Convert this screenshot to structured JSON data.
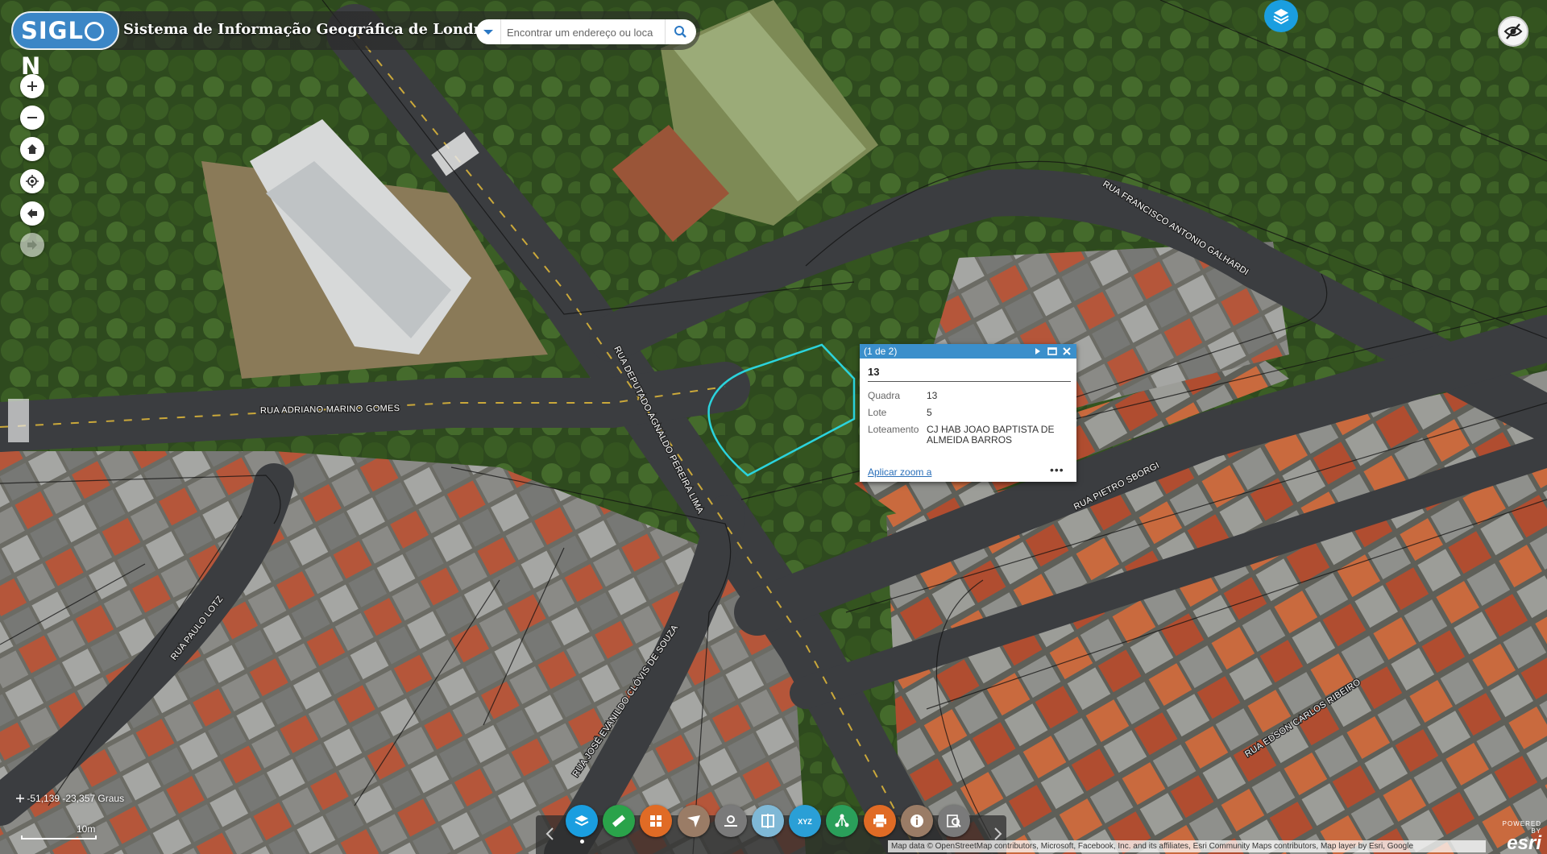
{
  "header": {
    "logo_text": "SIGLON",
    "title": "Sistema de Informação Geográfica de Londrina",
    "search_placeholder": "Encontrar um endereço ou loca"
  },
  "streets": [
    "RUA ADRIANO MARINO GOMES",
    "RUA DEPUTADO AGNALDO PEREIRA LIMA",
    "RUA FRANCISCO ANTONIO GALHARDI",
    "RUA PIETRO SBORGI",
    "RUA PAULO LOTZ",
    "RUA JOSÉ EVANILDO CLÓVIS DE SOUZA",
    "RUA EDSON CARLOS RIBEIRO"
  ],
  "popup": {
    "counter": "(1 de 2)",
    "title": "13",
    "fields": [
      {
        "key": "Quadra",
        "value": "13"
      },
      {
        "key": "Lote",
        "value": "5"
      },
      {
        "key": "Loteamento",
        "value": "CJ HAB JOAO BAPTISTA DE ALMEIDA BARROS"
      }
    ],
    "zoom_link": "Aplicar zoom a",
    "more": "•••"
  },
  "coordinates": "-51,139 -23,357 Graus",
  "scale_label": "10m",
  "attribution": "Map data © OpenStreetMap contributors, Microsoft, Facebook, Inc. and its affiliates, Esri Community Maps contributors, Map layer by Esri, Google",
  "esri": {
    "powered": "POWERED BY",
    "brand": "esri"
  },
  "nav_icons": [
    "zoom-in-icon",
    "zoom-out-icon",
    "home-icon",
    "locate-icon",
    "back-icon",
    "forward-icon"
  ],
  "toolbar_tools": [
    {
      "name": "layers-tool",
      "color": "#1a9ee0"
    },
    {
      "name": "measure-tool",
      "color": "#2aa34a"
    },
    {
      "name": "grid-tool",
      "color": "#e06b25"
    },
    {
      "name": "direction-tool",
      "color": "#9a7c66"
    },
    {
      "name": "route-tool",
      "color": "#7a7a7a"
    },
    {
      "name": "swipe-tool",
      "color": "#7fb8d6"
    },
    {
      "name": "xyz-tool",
      "color": "#2a9fd6"
    },
    {
      "name": "network-tool",
      "color": "#2a9f5a"
    },
    {
      "name": "print-tool",
      "color": "#e06b25"
    },
    {
      "name": "info-tool",
      "color": "#9a7c66"
    },
    {
      "name": "search-tool",
      "color": "#7a7a7a"
    }
  ],
  "colors": {
    "accent": "#3b8fcb",
    "parcel_outline": "#2bd3dc"
  }
}
